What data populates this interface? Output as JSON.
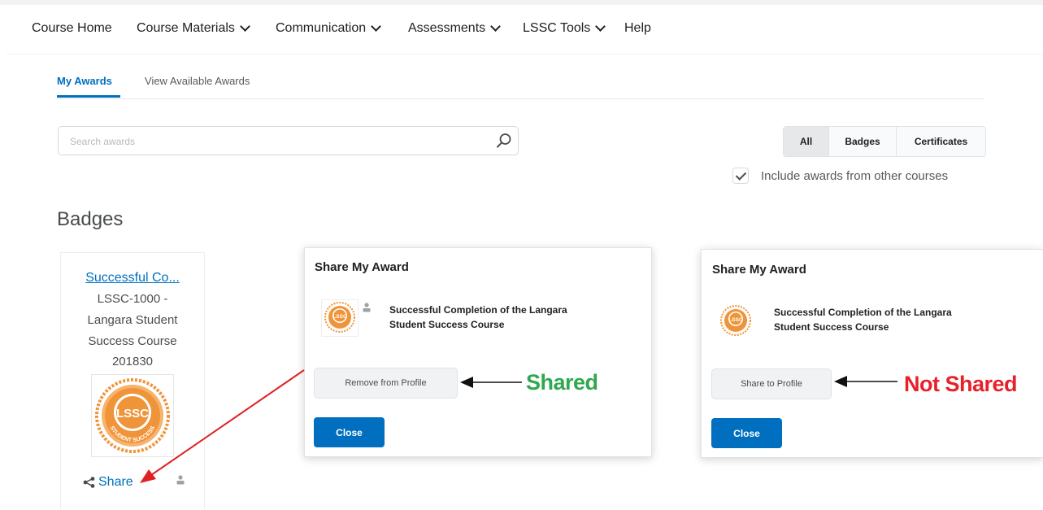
{
  "nav": {
    "items": [
      {
        "label": "Course Home",
        "dropdown": false
      },
      {
        "label": "Course Materials",
        "dropdown": true
      },
      {
        "label": "Communication",
        "dropdown": true
      },
      {
        "label": "Assessments",
        "dropdown": true
      },
      {
        "label": "LSSC Tools",
        "dropdown": true
      },
      {
        "label": "Help",
        "dropdown": false
      }
    ]
  },
  "tabs": [
    {
      "label": "My Awards",
      "active": true
    },
    {
      "label": "View Available Awards",
      "active": false
    }
  ],
  "search": {
    "placeholder": "Search awards",
    "value": ""
  },
  "filter": {
    "options": [
      "All",
      "Badges",
      "Certificates"
    ],
    "selected": "All"
  },
  "include_other": {
    "label": "Include awards  from other courses",
    "checked": true
  },
  "section_heading": "Badges",
  "badge_card": {
    "title": "Successful Co...",
    "lines": [
      "LSSC-1000 -",
      "Langara Student",
      "Success Course",
      "201830"
    ],
    "badge_text": "LSSC",
    "badge_subtext": "STUDENT SUCCESS",
    "share_label": "Share"
  },
  "dialog_shared": {
    "title": "Share My Award",
    "award_name_line1": "Successful Completion of the Langara",
    "award_name_line2": "Student Success Course",
    "action_label": "Remove from Profile",
    "close_label": "Close",
    "annotation": "Shared"
  },
  "dialog_not_shared": {
    "title": "Share My Award",
    "award_name_line1": "Successful Completion of the Langara",
    "award_name_line2": "Student Success Course",
    "action_label": "Share to Profile",
    "close_label": "Close",
    "annotation": "Not Shared"
  },
  "colors": {
    "link": "#006fbf",
    "primary_button": "#006fbf",
    "badge_orange": "#f0943a",
    "annotation_green": "#2fa84f",
    "annotation_red": "#e8202a",
    "arrow_red": "#e02020"
  }
}
